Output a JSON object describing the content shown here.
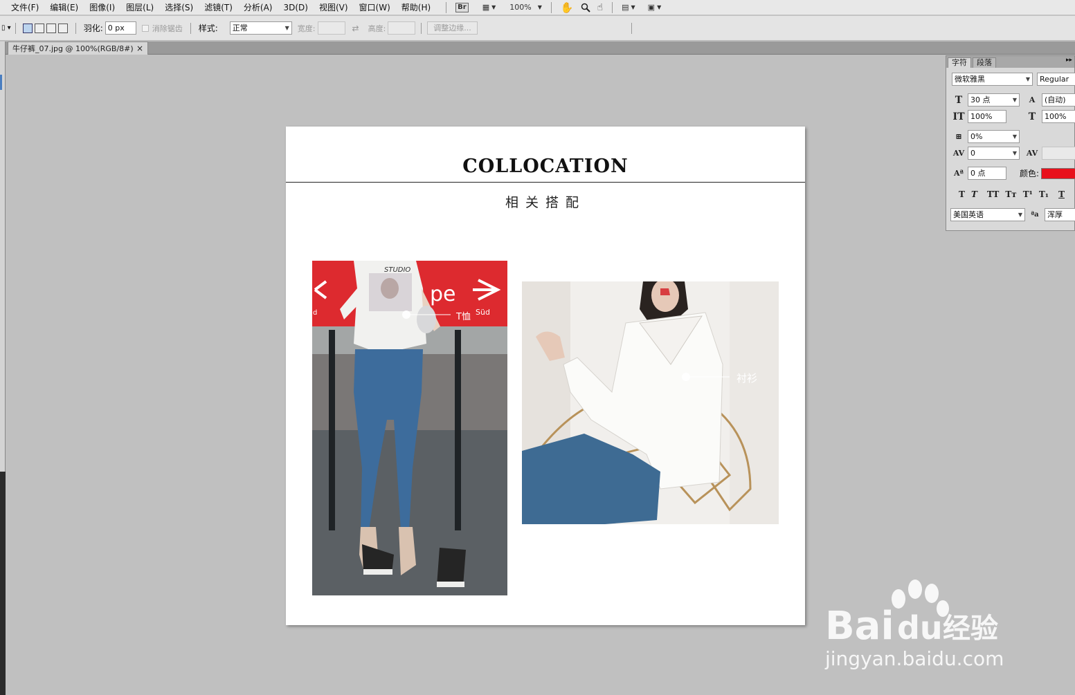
{
  "menubar": {
    "items": [
      "文件(F)",
      "编辑(E)",
      "图像(I)",
      "图层(L)",
      "选择(S)",
      "滤镜(T)",
      "分析(A)",
      "3D(D)",
      "视图(V)",
      "窗口(W)",
      "帮助(H)"
    ],
    "bridge": "Br",
    "zoom": "100%"
  },
  "options": {
    "feather_label": "羽化:",
    "feather_value": "0 px",
    "antialias_label": "消除锯齿",
    "style_label": "样式:",
    "style_value": "正常",
    "width_label": "宽度:",
    "height_label": "高度:",
    "refine_label": "调整边缘..."
  },
  "document": {
    "tab_title": "牛仔裤_07.jpg @ 100%(RGB/8#)",
    "close": "×"
  },
  "canvas": {
    "title": "COLLOCATION",
    "subtitle": "相关搭配",
    "photo1_text": {
      "studio": "STUDIO",
      "pe": "pe",
      "sud": "Süd",
      "d": "d",
      "tshirt_tag": "T恤"
    },
    "photo2_tag": "衬衫"
  },
  "char_panel": {
    "tabs": [
      "字符",
      "段落"
    ],
    "font_family": "微软雅黑",
    "font_style": "Regular",
    "font_size": "30 点",
    "leading": "(自动)",
    "vert_scale": "100%",
    "horiz_scale": "100%",
    "tsume": "0%",
    "tracking": "0",
    "baseline": "0 点",
    "color_label": "颜色:",
    "color": "#e8101c",
    "language": "美国英语",
    "antialias": "浑厚"
  },
  "watermark": {
    "brand": "Bai",
    "brand2": "du",
    "brand_suffix": "经验",
    "url": "jingyan.baidu.com"
  }
}
